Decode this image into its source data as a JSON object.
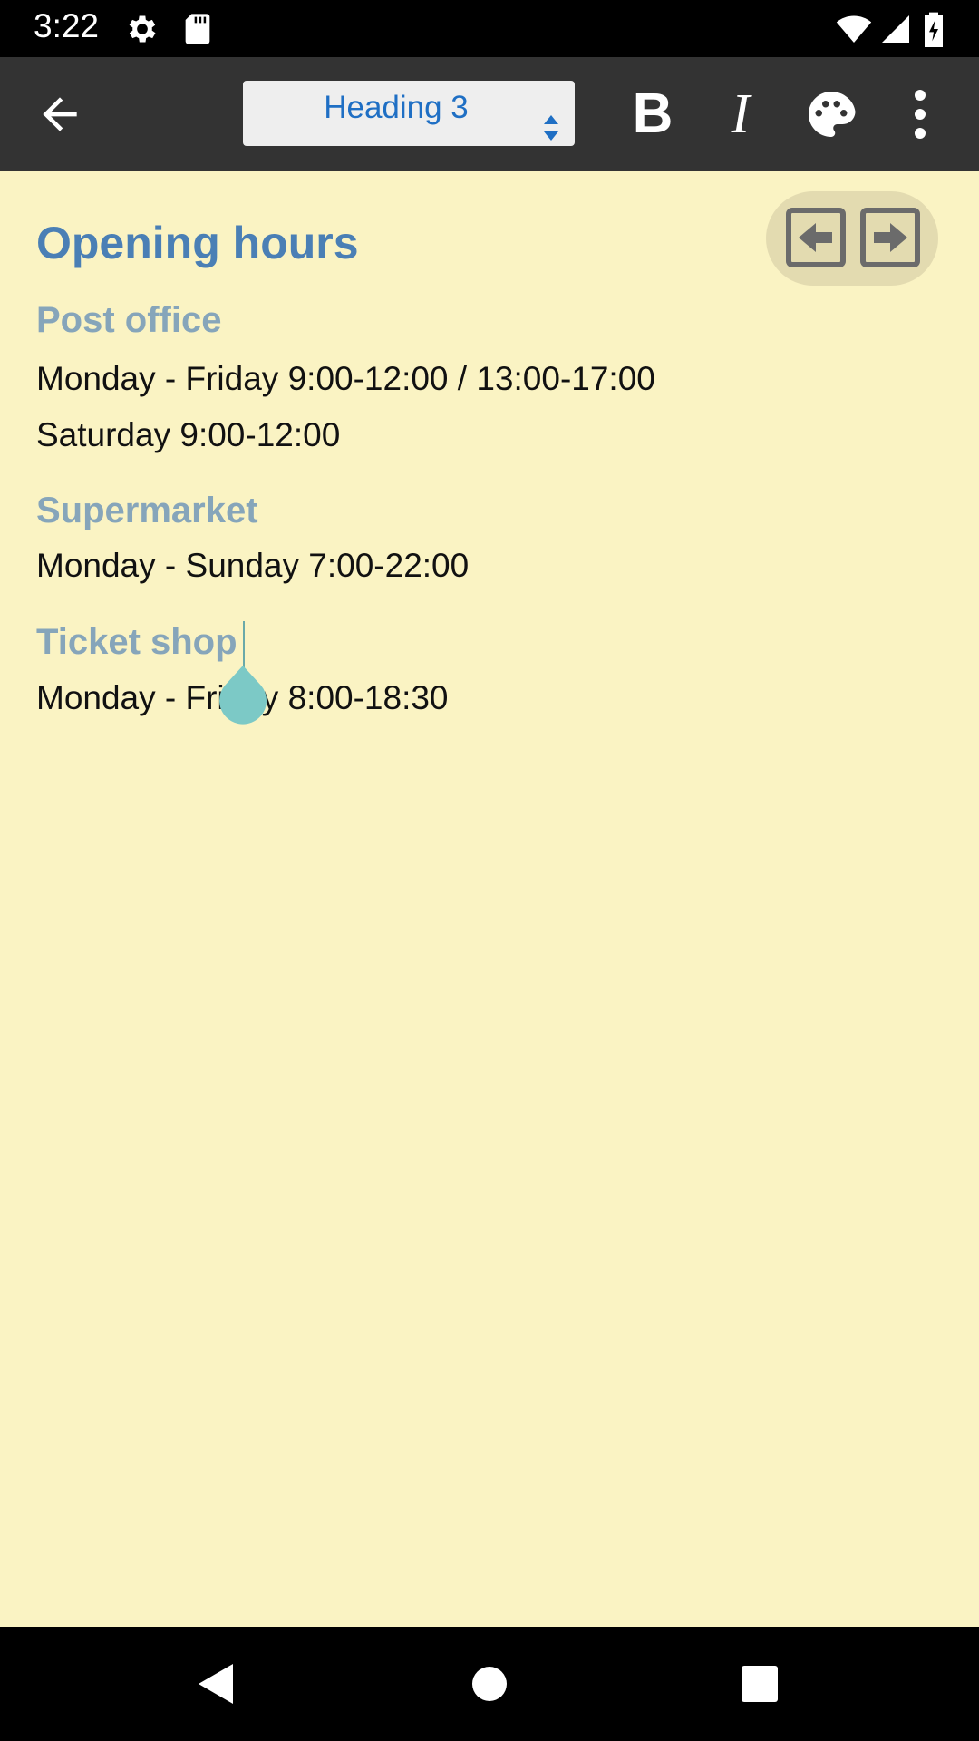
{
  "status_bar": {
    "time": "3:22",
    "left_icons": [
      "gear-icon",
      "sd-card-icon"
    ],
    "right_icons": [
      "wifi-icon",
      "cell-signal-icon",
      "battery-charging-icon"
    ]
  },
  "toolbar": {
    "back_icon": "arrow-left-icon",
    "style_select_value": "Heading 3",
    "bold_label": "B",
    "italic_label": "I",
    "palette_icon": "palette-icon",
    "more_icon": "more-vert-icon"
  },
  "document": {
    "title": "Opening hours",
    "sections": [
      {
        "heading": "Post office",
        "lines": [
          "Monday - Friday 9:00-12:00 / 13:00-17:00",
          "Saturday 9:00-12:00"
        ]
      },
      {
        "heading": "Supermarket",
        "lines": [
          "Monday - Sunday 7:00-22:00"
        ]
      },
      {
        "heading": "Ticket shop",
        "lines": [
          "Monday - Friday 8:00-18:30"
        ]
      }
    ]
  },
  "colors": {
    "background": "#faf3c3",
    "toolbar": "#333333",
    "title": "#4a7fb5",
    "heading": "#86a5ba",
    "accent_select_text": "#1f6fc4",
    "caret": "#7cc9c6"
  },
  "navigation_bar": [
    "back-triangle-icon",
    "home-circle-icon",
    "recents-square-icon"
  ]
}
